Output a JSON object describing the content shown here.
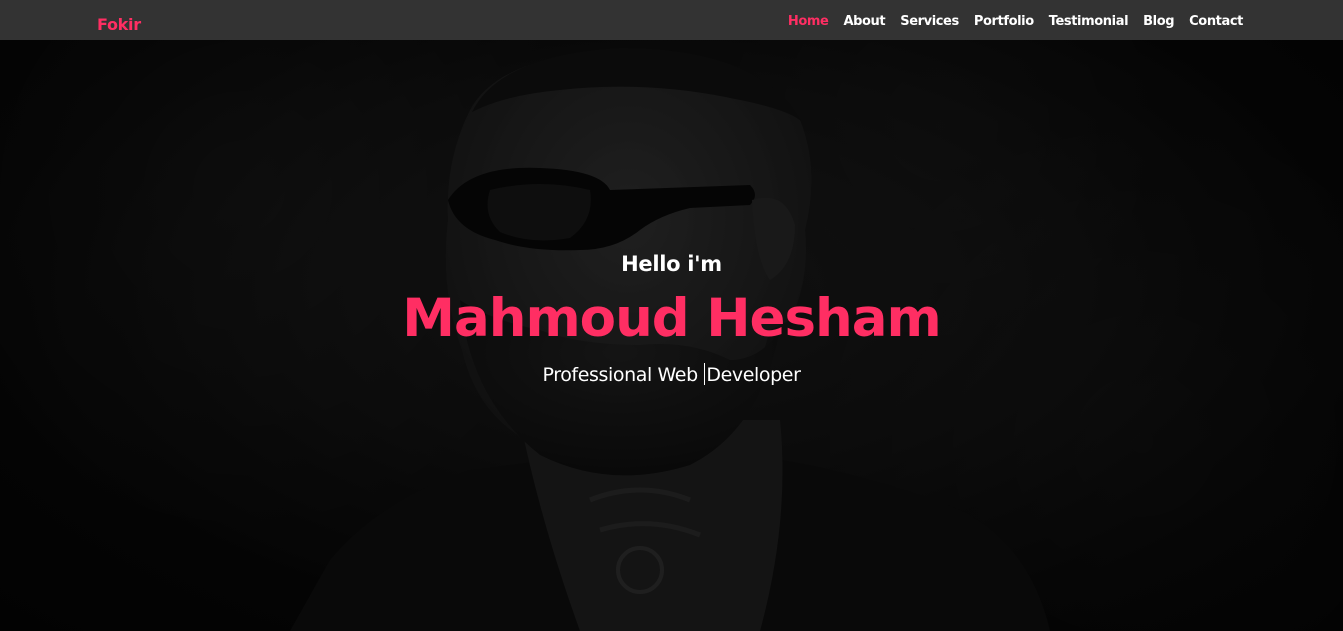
{
  "navbar": {
    "brand": "Fokir",
    "links": [
      {
        "label": "Home",
        "active": true
      },
      {
        "label": "About",
        "active": false
      },
      {
        "label": "Services",
        "active": false
      },
      {
        "label": "Portfolio",
        "active": false
      },
      {
        "label": "Testimonial",
        "active": false
      },
      {
        "label": "Blog",
        "active": false
      },
      {
        "label": "Contact",
        "active": false
      }
    ]
  },
  "hero": {
    "greeting": "Hello i'm",
    "name": "Mahmoud Hesham",
    "role_before_caret": "Professional Web ",
    "role_after_caret": "Developer",
    "background_image": "portrait-of-bearded-man-with-sunglasses"
  },
  "colors": {
    "accent": "#ff2e63",
    "navbar_bg": "#333333",
    "text": "#ffffff"
  }
}
